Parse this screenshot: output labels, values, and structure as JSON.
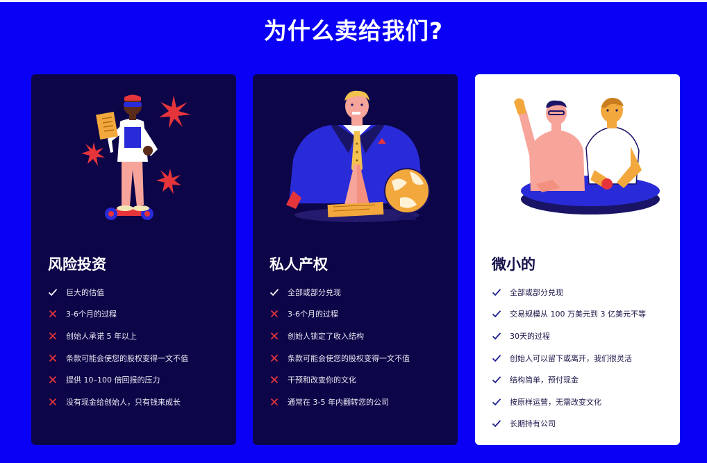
{
  "page": {
    "title": "为什么卖给我们?"
  },
  "colors": {
    "background": "#0a00f5",
    "card_dark": "#0c0548",
    "card_light": "#ffffff",
    "check_dark": "#ffffff",
    "check_light": "#1a1a8c",
    "cross": "#e5353b"
  },
  "cards": [
    {
      "title": "风险投资",
      "illustration": "person-with-document-on-hoverboard",
      "features": [
        {
          "icon": "check-icon",
          "text": "巨大的估值"
        },
        {
          "icon": "cross-icon",
          "text": "3-6个月的过程"
        },
        {
          "icon": "cross-icon",
          "text": "创始人承诺 5 年以上"
        },
        {
          "icon": "cross-icon",
          "text": "条款可能会使您的股权变得一文不值"
        },
        {
          "icon": "cross-icon",
          "text": "提供 10–100 倍回报的压力"
        },
        {
          "icon": "cross-icon",
          "text": "没有现金给创始人，只有钱来成长"
        }
      ]
    },
    {
      "title": "私人产权",
      "illustration": "businessman-with-globe",
      "features": [
        {
          "icon": "check-icon",
          "text": "全部或部分兑现"
        },
        {
          "icon": "cross-icon",
          "text": "3-6个月的过程"
        },
        {
          "icon": "cross-icon",
          "text": "创始人锁定了收入结构"
        },
        {
          "icon": "cross-icon",
          "text": "条款可能会使您的股权变得一文不值"
        },
        {
          "icon": "cross-icon",
          "text": "干预和改变你的文化"
        },
        {
          "icon": "cross-icon",
          "text": "通常在 3-5 年内翻转您的公司"
        }
      ]
    },
    {
      "title": "微小的",
      "illustration": "two-people-at-table",
      "features": [
        {
          "icon": "check-icon",
          "text": "全部或部分兑现"
        },
        {
          "icon": "check-icon",
          "text": "交易规模从 100 万美元到 3 亿美元不等"
        },
        {
          "icon": "check-icon",
          "text": "30天的过程"
        },
        {
          "icon": "check-icon",
          "text": "创始人可以留下或离开，我们很灵活"
        },
        {
          "icon": "check-icon",
          "text": "结构简单，预付现金"
        },
        {
          "icon": "check-icon",
          "text": "按原样运营，无需改变文化"
        },
        {
          "icon": "check-icon",
          "text": "长期持有公司"
        }
      ]
    }
  ]
}
